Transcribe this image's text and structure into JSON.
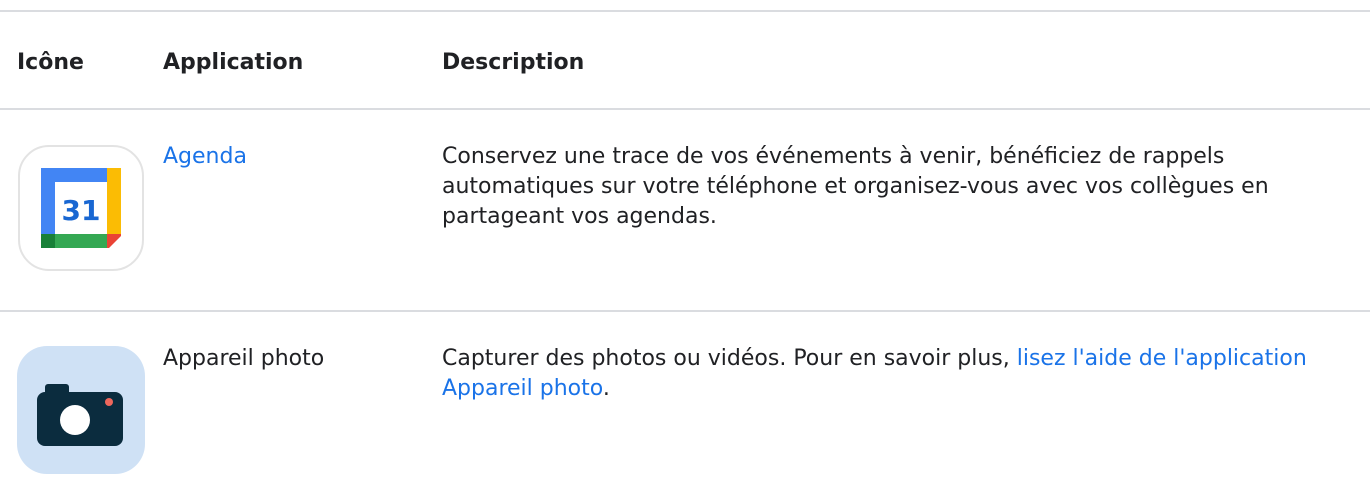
{
  "table": {
    "headers": {
      "icon": "Icône",
      "application": "Application",
      "description": "Description"
    },
    "rows": [
      {
        "icon": "calendar-app-icon",
        "app_name": "Agenda",
        "app_is_link": true,
        "calendar_day": "31",
        "description": "Conservez une trace de vos événements à venir, bénéficiez de rappels automatiques sur votre téléphone et organisez-vous avec vos collègues en partageant vos agendas."
      },
      {
        "icon": "camera-app-icon",
        "app_name": "Appareil photo",
        "app_is_link": false,
        "description_prefix": "Capturer des photos ou vidéos. Pour en savoir plus, ",
        "description_link": "lisez l'aide de l'application Appareil photo",
        "description_suffix": "."
      }
    ]
  },
  "colors": {
    "link": "#1a73e8",
    "divider": "#dadce0",
    "text": "#202124"
  }
}
